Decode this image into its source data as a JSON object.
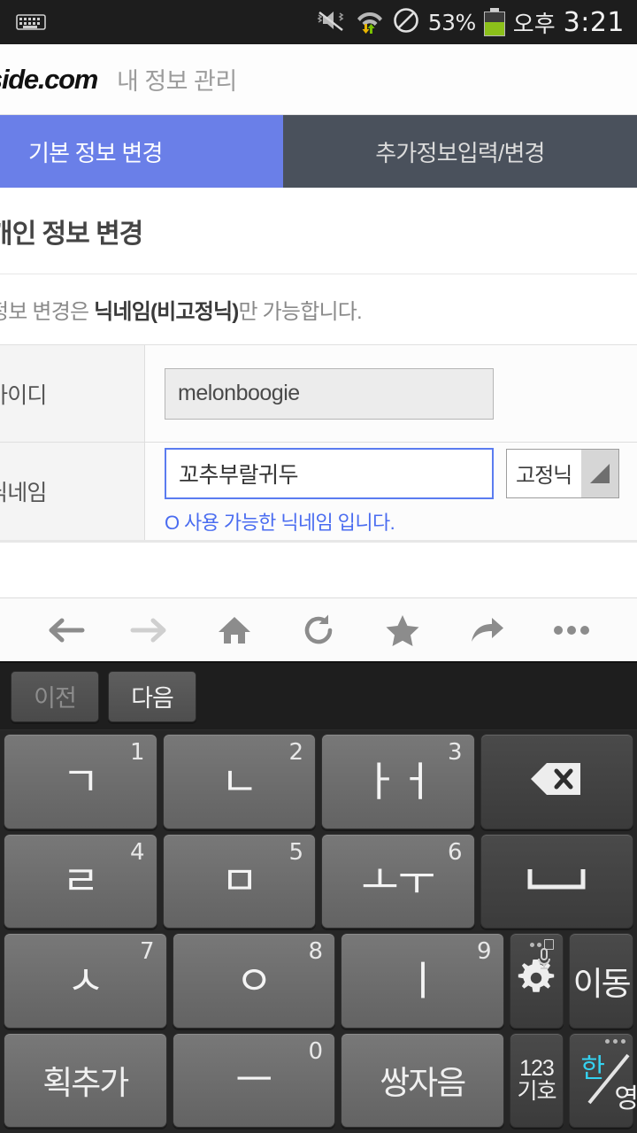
{
  "statusbar": {
    "keyboard_icon": "keyboard-icon",
    "mute_icon": "vibrate-mute-icon",
    "wifi_icon": "wifi-transfer-icon",
    "noentry_icon": "do-not-disturb-icon",
    "battery_percent": "53%",
    "battery_icon": "battery-icon",
    "ampm": "오후",
    "time": "3:21"
  },
  "site": {
    "logo": "side.com",
    "subtitle": "내 정보 관리"
  },
  "tabs": [
    {
      "label": "기본 정보 변경",
      "active": true
    },
    {
      "label": "추가정보입력/변경",
      "active": false
    }
  ],
  "page": {
    "title": "개인 정보 변경",
    "notice_prefix": "정보 변경은 ",
    "notice_bold": "닉네임(비고정닉)",
    "notice_suffix": "만 가능합니다."
  },
  "form": {
    "rows": [
      {
        "label": "아이디",
        "value": "melonboogie",
        "readonly": true
      },
      {
        "label": "닉네임",
        "value": "꼬추부랄귀두",
        "readonly": false,
        "select_value": "고정닉",
        "helper": "O 사용 가능한 닉네임 입니다."
      }
    ]
  },
  "browser_toolbar": [
    {
      "name": "back-button",
      "icon": "arrow-left-icon"
    },
    {
      "name": "forward-button",
      "icon": "arrow-right-icon"
    },
    {
      "name": "home-button",
      "icon": "home-icon"
    },
    {
      "name": "reload-button",
      "icon": "refresh-icon"
    },
    {
      "name": "bookmark-button",
      "icon": "star-icon"
    },
    {
      "name": "share-button",
      "icon": "share-arrow-icon"
    },
    {
      "name": "menu-button",
      "icon": "more-dots-icon"
    }
  ],
  "keyboard": {
    "suggestions": [
      {
        "label": "이전",
        "enabled": false
      },
      {
        "label": "다음",
        "enabled": true
      }
    ],
    "rows": [
      [
        {
          "main": "ㄱ",
          "num": "1"
        },
        {
          "main": "ㄴ",
          "num": "2"
        },
        {
          "main": "ㅏㅓ",
          "num": "3"
        },
        {
          "main": "",
          "num": "",
          "icon": "backspace-icon"
        }
      ],
      [
        {
          "main": "ㄹ",
          "num": "4"
        },
        {
          "main": "ㅁ",
          "num": "5"
        },
        {
          "main": "ㅗㅜ",
          "num": "6"
        },
        {
          "main": "",
          "num": "",
          "icon": "space-icon"
        }
      ],
      [
        {
          "main": "ㅅ",
          "num": "7"
        },
        {
          "main": "ㅇ",
          "num": "8"
        },
        {
          "main": "ㅣ",
          "num": "9"
        },
        {
          "main": "",
          "num": "",
          "icon": "settings-gear-icon"
        },
        {
          "main": "이동",
          "num": ""
        }
      ],
      [
        {
          "main": "획추가",
          "num": ""
        },
        {
          "main": "ㅡ",
          "num": "0"
        },
        {
          "main": "쌍자음",
          "num": ""
        },
        {
          "line1": "123",
          "line2": "기호"
        },
        {
          "line1": "한",
          "line2": "영"
        }
      ]
    ]
  }
}
